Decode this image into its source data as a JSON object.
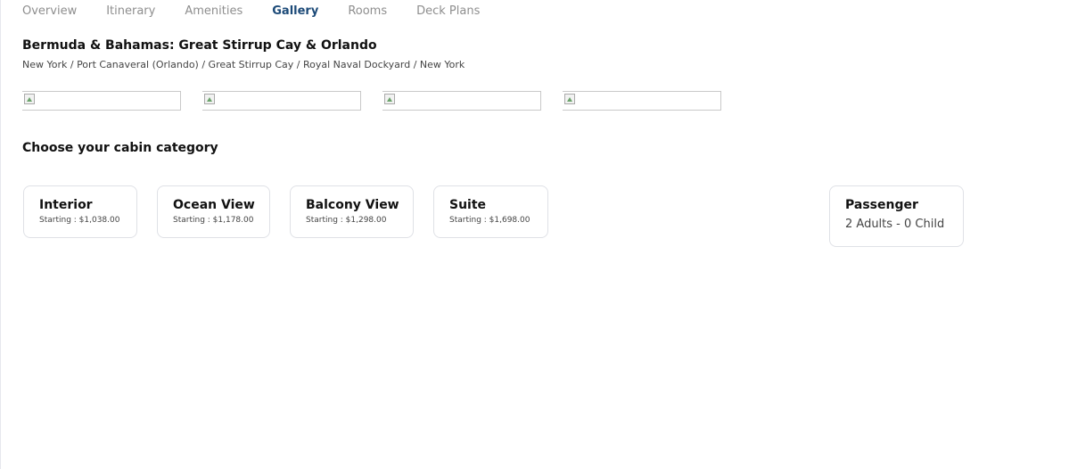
{
  "tabs": [
    {
      "label": "Overview"
    },
    {
      "label": "Itinerary"
    },
    {
      "label": "Amenities"
    },
    {
      "label": "Gallery",
      "active": true
    },
    {
      "label": "Rooms"
    },
    {
      "label": "Deck Plans"
    }
  ],
  "cruise": {
    "title": "Bermuda & Bahamas: Great Stirrup Cay & Orlando",
    "route": "New York / Port Canaveral (Orlando) / Great Stirrup Cay / Royal Naval Dockyard / New York"
  },
  "gallery": {
    "image_count": 4
  },
  "cabin_section": {
    "title": "Choose your cabin category",
    "cabins": [
      {
        "name": "Interior",
        "price": "Starting : $1,038.00"
      },
      {
        "name": "Ocean View",
        "price": "Starting : $1,178.00"
      },
      {
        "name": "Balcony View",
        "price": "Starting : $1,298.00"
      },
      {
        "name": "Suite",
        "price": "Starting : $1,698.00"
      }
    ]
  },
  "passenger": {
    "title": "Passenger",
    "value": "2 Adults - 0 Child"
  },
  "colors": {
    "active_tab": "#1c4a78",
    "inactive_tab": "#8e8e8e",
    "card_border": "#dfe1e6"
  },
  "icons": {
    "gallery_placeholder": "broken-image-icon"
  }
}
